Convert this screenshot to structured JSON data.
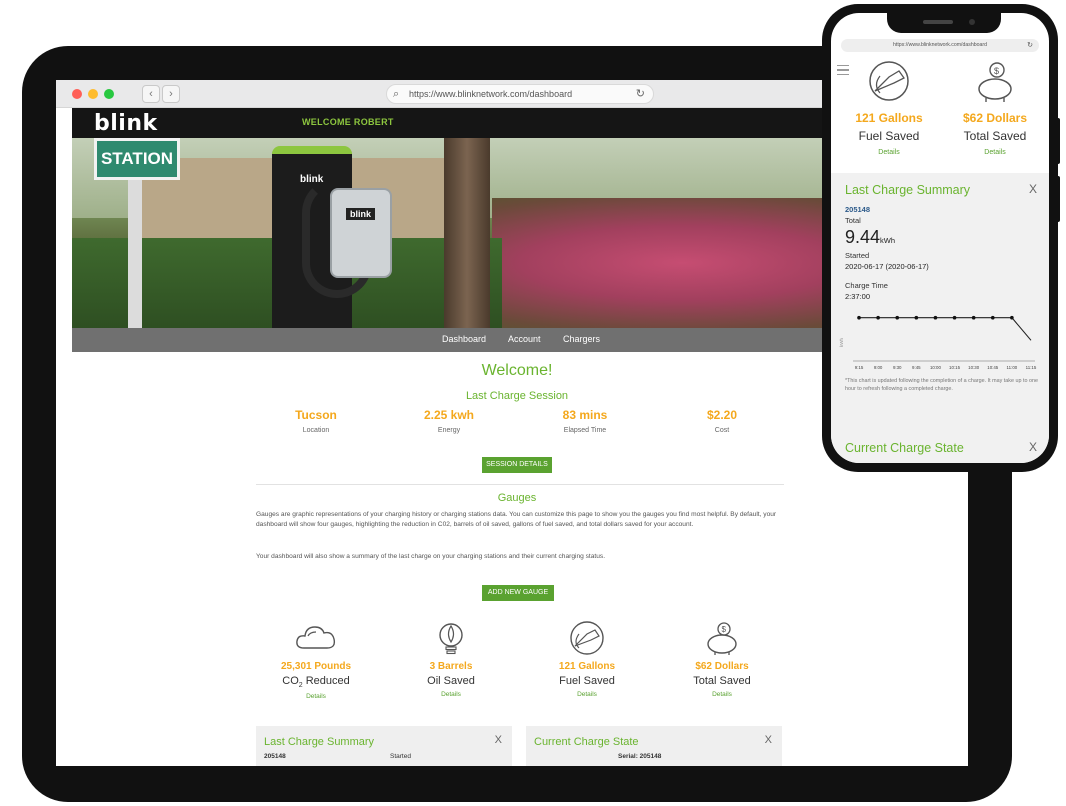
{
  "browser": {
    "url": "https://www.blinknetwork.com/dashboard",
    "back_icon": "chevron-left-icon",
    "forward_icon": "chevron-right-icon",
    "colors": {
      "close": "#ff5f57",
      "minimize": "#febc2e",
      "maximize": "#28c840"
    }
  },
  "header": {
    "logo": "blink",
    "welcome": "WELCOME ROBERT"
  },
  "hero": {
    "sign_text": "STATION",
    "charger_brand": "blink"
  },
  "nav": {
    "items": [
      "Dashboard",
      "Account",
      "Chargers"
    ]
  },
  "welcome": {
    "title": "Welcome!",
    "section_title": "Last Charge Session",
    "stats": [
      {
        "value": "Tucson",
        "label": "Location"
      },
      {
        "value": "2.25 kwh",
        "label": "Energy"
      },
      {
        "value": "83 mins",
        "label": "Elapsed Time"
      },
      {
        "value": "$2.20",
        "label": "Cost"
      }
    ],
    "session_button": "SESSION DETAILS"
  },
  "gauges": {
    "title": "Gauges",
    "paragraph1": "Gauges are graphic representations of your charging history or charging stations data. You can customize this page to show you the gauges you find most helpful. By default, your dashboard will show four gauges, highlighting the reduction in C02, barrels of oil saved, gallons of fuel saved, and total dollars saved for your account.",
    "paragraph2": "Your dashboard will also show a summary of the last charge on your charging stations and their current charging status.",
    "add_button": "ADD NEW GAUGE",
    "items": [
      {
        "icon": "cloud-icon",
        "value": "25,301 Pounds",
        "label_main": "CO",
        "label_sub": "2",
        "label_rest": " Reduced",
        "details": "Details"
      },
      {
        "icon": "oil-drop-icon",
        "value": "3 Barrels",
        "label_main": "Oil Saved",
        "label_sub": "",
        "label_rest": "",
        "details": "Details"
      },
      {
        "icon": "fuel-nozzle-icon",
        "value": "121 Gallons",
        "label_main": "Fuel Saved",
        "label_sub": "",
        "label_rest": "",
        "details": "Details"
      },
      {
        "icon": "piggy-bank-icon",
        "value": "$62 Dollars",
        "label_main": "Total Saved",
        "label_sub": "",
        "label_rest": "",
        "details": "Details"
      }
    ]
  },
  "panels": {
    "last_charge": {
      "title": "Last Charge Summary",
      "close": "X",
      "serial": "205148",
      "started": "Started"
    },
    "current_state": {
      "title": "Current Charge State",
      "close": "X",
      "serial": "Serial: 205148"
    }
  },
  "phone": {
    "url": "https://www.blinknetwork.com/dashboard",
    "gauges": [
      {
        "icon": "fuel-nozzle-icon",
        "value": "121 Gallons",
        "label": "Fuel Saved",
        "details": "Details"
      },
      {
        "icon": "piggy-bank-icon",
        "value": "$62 Dollars",
        "label": "Total Saved",
        "details": "Details"
      }
    ],
    "summary": {
      "title": "Last Charge Summary",
      "close": "X",
      "serial": "205148",
      "total_label": "Total",
      "total_value": "9.44",
      "total_unit": "kWh",
      "started_label": "Started",
      "started_value": "2020-06-17 (2020-06-17)",
      "charge_time_label": "Charge Time",
      "charge_time_value": "2:37:00",
      "y_axis_label": "kWh",
      "note": "*This chart is updated following the completion of a charge. It may take up to one hour to refresh following a completed charge."
    },
    "current_state": {
      "title": "Current Charge State",
      "close": "X"
    }
  },
  "chart_data": {
    "type": "line",
    "x": [
      "9:15",
      "9:00",
      "9:30",
      "9:45",
      "10:00",
      "10:15",
      "10:30",
      "10:45",
      "11:00",
      "11:15"
    ],
    "series": [
      {
        "values": [
          9.44,
          9.44,
          9.44,
          9.44,
          9.44,
          9.44,
          9.44,
          9.44,
          9.44,
          8.9
        ]
      }
    ],
    "ylabel": "kWh",
    "ylim": [
      8.5,
      9.6
    ],
    "grid": false
  }
}
